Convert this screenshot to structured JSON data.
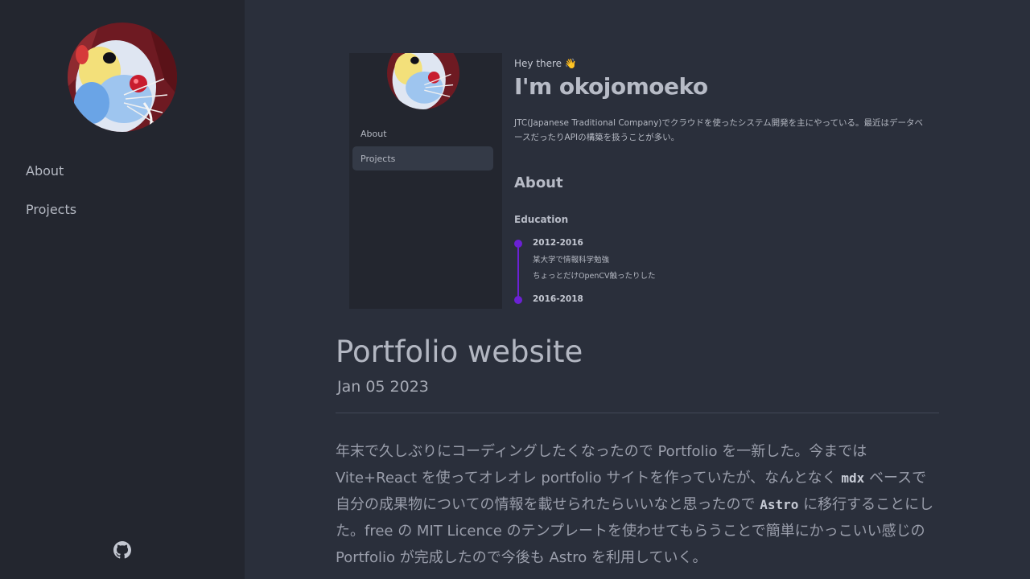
{
  "sidebar": {
    "nav": [
      {
        "label": "About"
      },
      {
        "label": "Projects"
      }
    ],
    "github_icon": "github-icon"
  },
  "preview": {
    "nav": [
      "About",
      "Projects"
    ],
    "greeting": "Hey there 👋",
    "name": "I'm okojomoeko",
    "description": "JTC(Japanese Traditional Company)でクラウドを使ったシステム開発を主にやっている。最近はデータベースだったりAPIの構築を扱うことが多い。",
    "about_heading": "About",
    "education_heading": "Education",
    "timeline": [
      {
        "year": "2012-2016",
        "line1": "某大学で情報科学勉強",
        "line2": "ちょっとだけOpenCV触ったりした"
      },
      {
        "year": "2016-2018"
      }
    ]
  },
  "post": {
    "title": "Portfolio website",
    "date": "Jan 05 2023",
    "body": {
      "p1": "年末で久しぶりにコーディングしたくなったので Portfolio を一新した。今までは Vite+React を使ってオレオレ portfolio サイトを作っていたが、なんとなく ",
      "code1": "mdx",
      "p2": " ベースで自分の成果物についての情報を載せられたらいいなと思ったので ",
      "code2": "Astro",
      "p3": " に移行することにした。free の MIT Licence のテンプレートを使わせてもらうことで簡単にかっこいい感じの Portfolio が完成したので今後も Astro を利用していく。"
    }
  }
}
